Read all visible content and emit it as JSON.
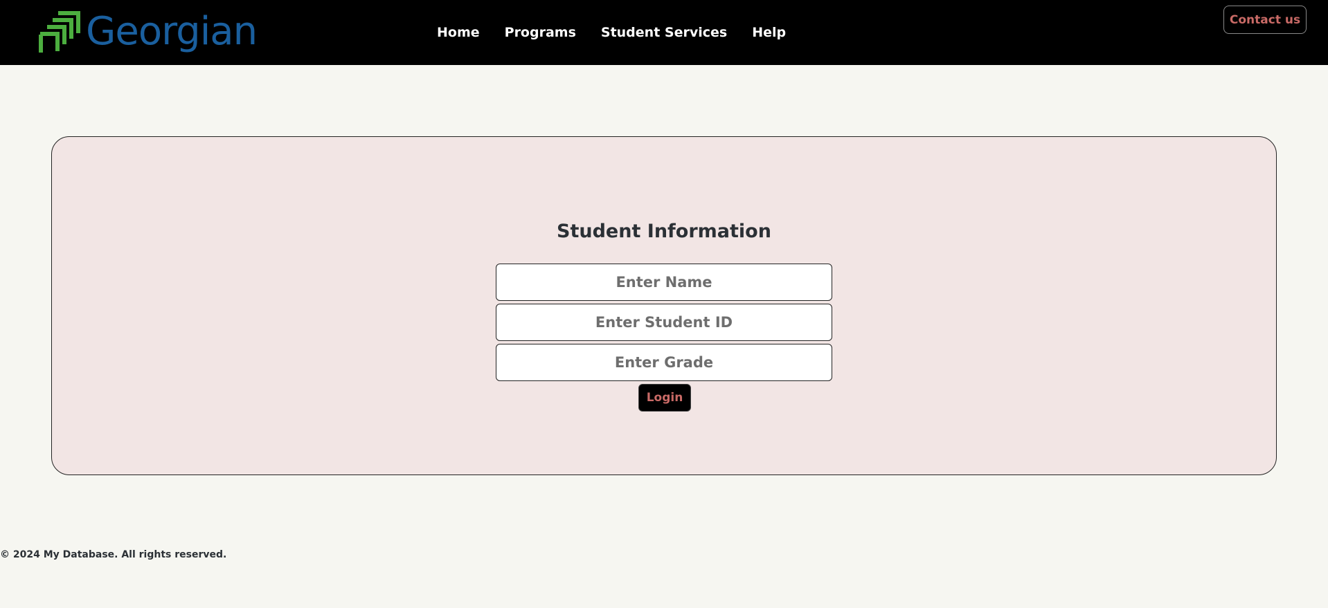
{
  "header": {
    "logo_text": "Georgian",
    "logo_colors": {
      "text": "#1a5f9e",
      "mark": "#4cae3f"
    },
    "nav": [
      {
        "label": "Home"
      },
      {
        "label": "Programs"
      },
      {
        "label": "Student Services"
      },
      {
        "label": "Help"
      }
    ],
    "contact_label": "Contact us"
  },
  "form": {
    "title": "Student Information",
    "name_placeholder": "Enter Name",
    "student_id_placeholder": "Enter Student ID",
    "grade_placeholder": "Enter Grade",
    "login_label": "Login"
  },
  "footer": {
    "text": "© 2024 My Database. All rights reserved."
  },
  "colors": {
    "page_bg": "#f6f6f1",
    "navbar_bg": "#000000",
    "panel_bg": "#f2e5e4",
    "accent": "#c96a66"
  }
}
